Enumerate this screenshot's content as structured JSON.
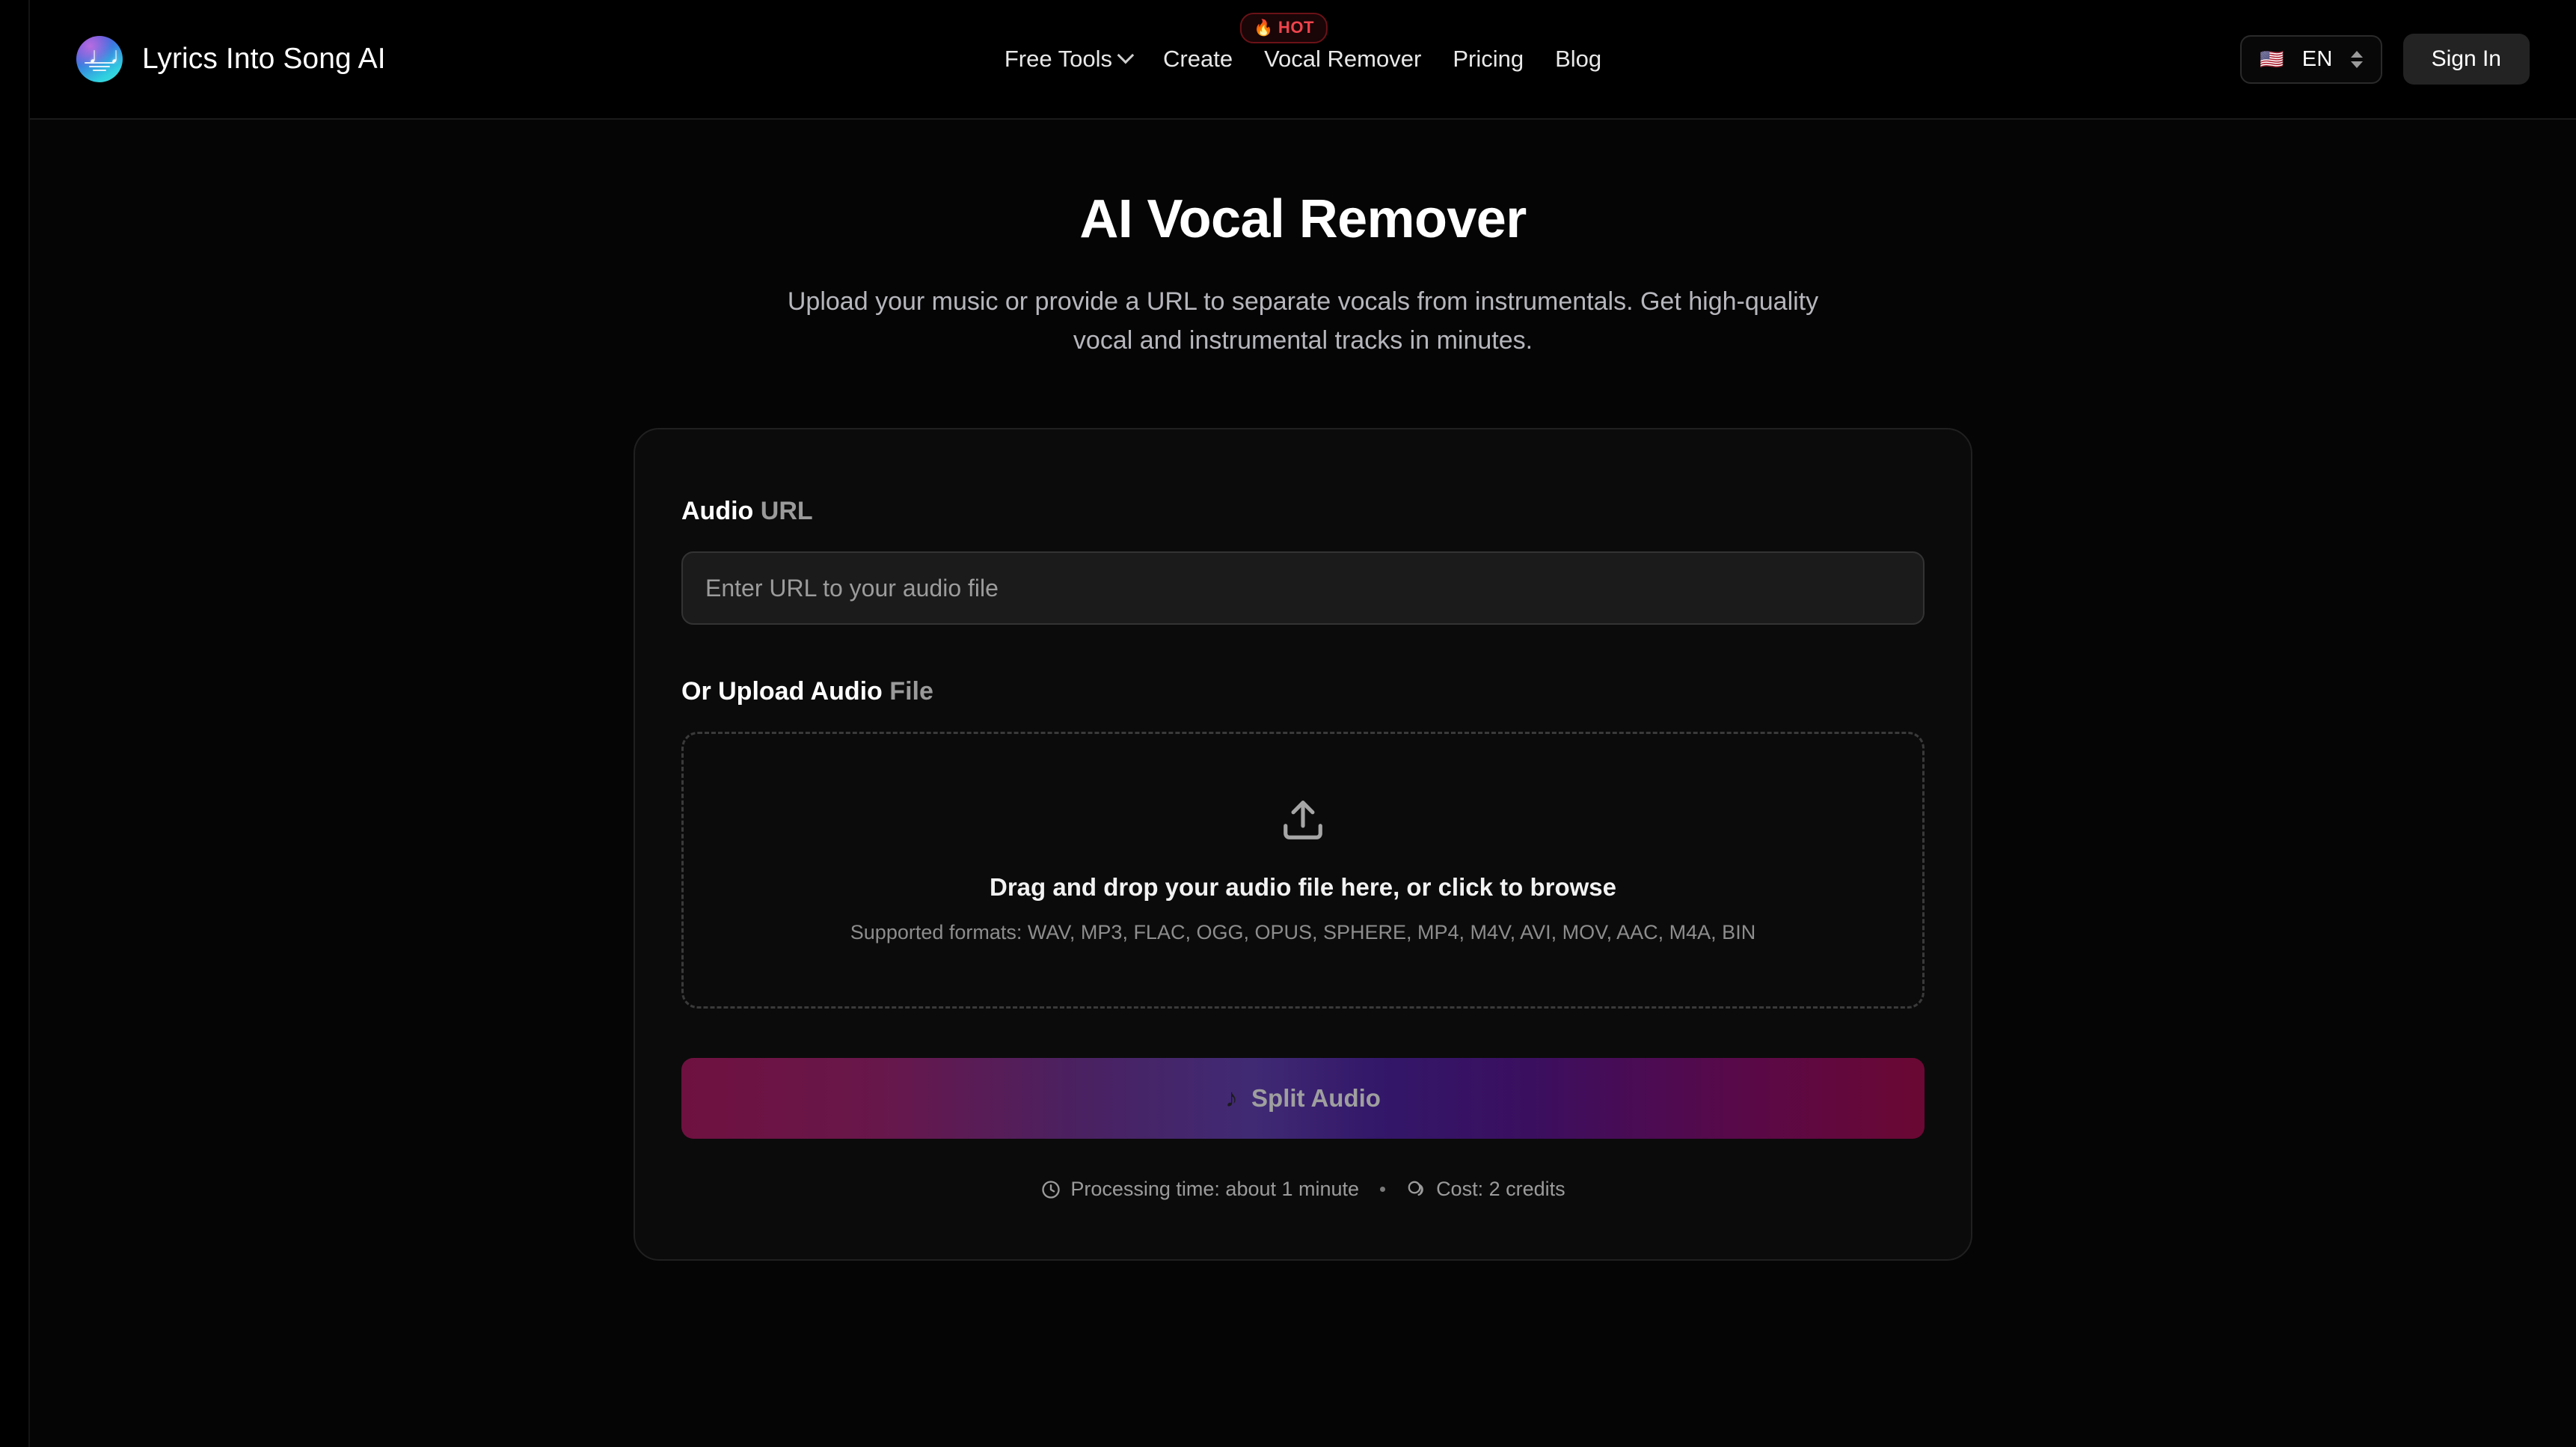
{
  "header": {
    "brand_name": "Lyrics Into Song AI",
    "logo_icon": "music-notes-circle-logo",
    "nav": [
      {
        "label": "Free Tools",
        "icon": "chevron-down-icon",
        "has_dropdown": true
      },
      {
        "label": "Create",
        "badge": "HOT",
        "badge_icon": "flame-icon"
      },
      {
        "label": "Vocal Remover"
      },
      {
        "label": "Pricing"
      },
      {
        "label": "Blog"
      }
    ],
    "language": {
      "flag": "🇺🇸",
      "code": "EN",
      "icon": "chevron-up-down-icon"
    },
    "sign_in_label": "Sign In"
  },
  "hero": {
    "title": "AI Vocal Remover",
    "subtitle": "Upload your music or provide a URL to separate vocals from instrumentals. Get high-quality vocal and instrumental tracks in minutes."
  },
  "form": {
    "url_label_strong": "Audio",
    "url_label_dim": "URL",
    "url_value": "",
    "url_placeholder": "Enter URL to your audio file",
    "upload_label_strong": "Or Upload Audio",
    "upload_label_dim": "File",
    "dropzone": {
      "icon": "upload-icon",
      "title": "Drag and drop your audio file here, or click to browse",
      "formats": "Supported formats: WAV, MP3, FLAC, OGG, OPUS, SPHERE, MP4, M4V, AVI, MOV, AAC, M4A, BIN"
    },
    "submit": {
      "label": "Split Audio",
      "icon": "music-note-icon",
      "disabled": true
    },
    "meta": {
      "time_icon": "clock-icon",
      "time_text": "Processing time: about 1 minute",
      "cost_icon": "coins-icon",
      "cost_text": "Cost: 2 credits"
    }
  },
  "colors": {
    "page_background": "#050505",
    "card_background": "#0b0b0b",
    "card_border": "#202020",
    "input_background": "#1b1b1b",
    "accent_crimson": "#6f1140",
    "accent_indigo": "#331769",
    "hot_red": "#f0444c",
    "muted_text": "#9a9a9a"
  }
}
